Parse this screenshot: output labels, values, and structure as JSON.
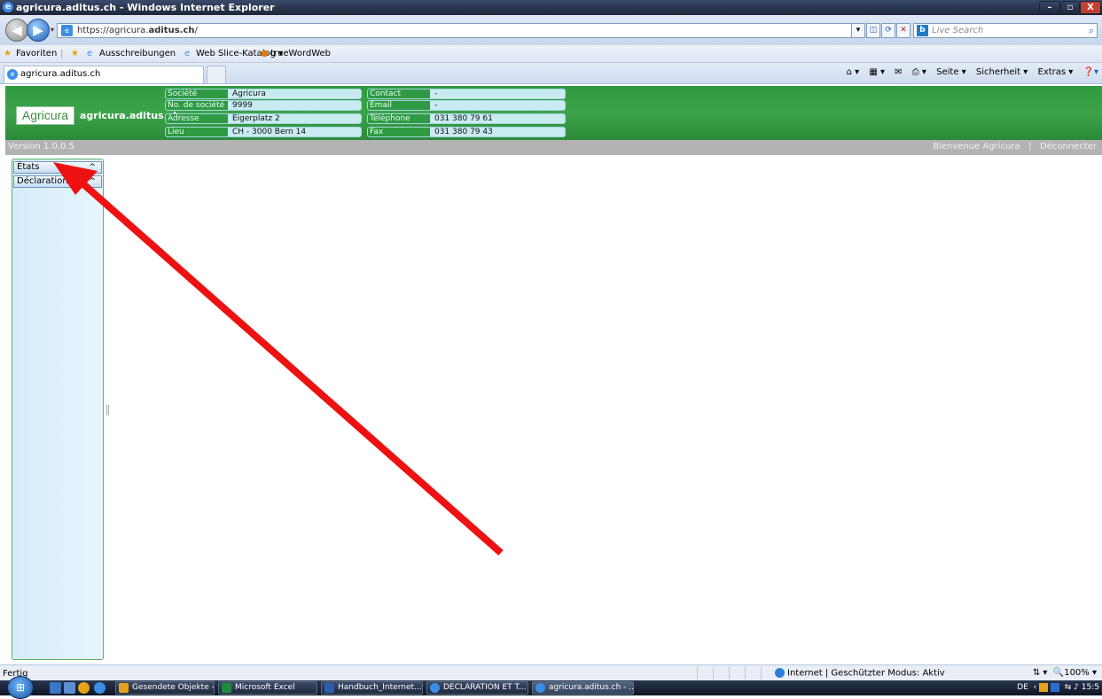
{
  "window": {
    "title": "agricura.aditus.ch - Windows Internet Explorer",
    "minimize": "–",
    "maximize": "▫",
    "close": "X"
  },
  "address": {
    "url_prefix": "https://agricura.",
    "url_bold": "aditus.ch",
    "url_suffix": "/",
    "search_placeholder": "Live Search"
  },
  "favorites": {
    "label": "Favoriten",
    "items": [
      "Ausschreibungen",
      "Web Slice-Katalog ▾",
      "trueWordWeb"
    ]
  },
  "tabs": {
    "active_label": "agricura.aditus.ch"
  },
  "command_bar": {
    "items": [
      "Seite ▾",
      "Sicherheit ▾",
      "Extras ▾"
    ]
  },
  "header": {
    "logo_text": "Agricura",
    "site_name": "agricura.aditus.ch",
    "fields_left": [
      {
        "label": "Société",
        "value": "Agricura"
      },
      {
        "label": "No. de société",
        "value": "9999"
      },
      {
        "label": "Adresse",
        "value": "Eigerplatz 2"
      },
      {
        "label": "Lieu",
        "value": "CH - 3000 Bern 14"
      }
    ],
    "fields_right": [
      {
        "label": "Contact",
        "value": "-"
      },
      {
        "label": "Email",
        "value": "-"
      },
      {
        "label": "Téléphone",
        "value": "031 380 79 61"
      },
      {
        "label": "Fax",
        "value": "031 380 79 43"
      }
    ]
  },
  "version_bar": {
    "version": "Version 1.0.0.5",
    "welcome": "Bienvenue Agricura",
    "separator": "|",
    "logout": "Déconnecter"
  },
  "sidebar": {
    "sections": [
      {
        "label": "États"
      },
      {
        "label": "Déclarations"
      }
    ]
  },
  "status_bar": {
    "status": "Fertig",
    "zone": "Internet | Geschützter Modus: Aktiv",
    "zoom": "100%"
  },
  "taskbar": {
    "tasks": [
      "Gesendete Objekte -...",
      "Microsoft Excel",
      "Handbuch_Internet...",
      "DECLARATION ET T...",
      "agricura.aditus.ch - ..."
    ],
    "lang": "DE",
    "clock": "15:5"
  },
  "colors": {
    "header_green": "#2f9a3f",
    "arrow_red": "#ee1111",
    "sidebar_border": "#54b066"
  }
}
